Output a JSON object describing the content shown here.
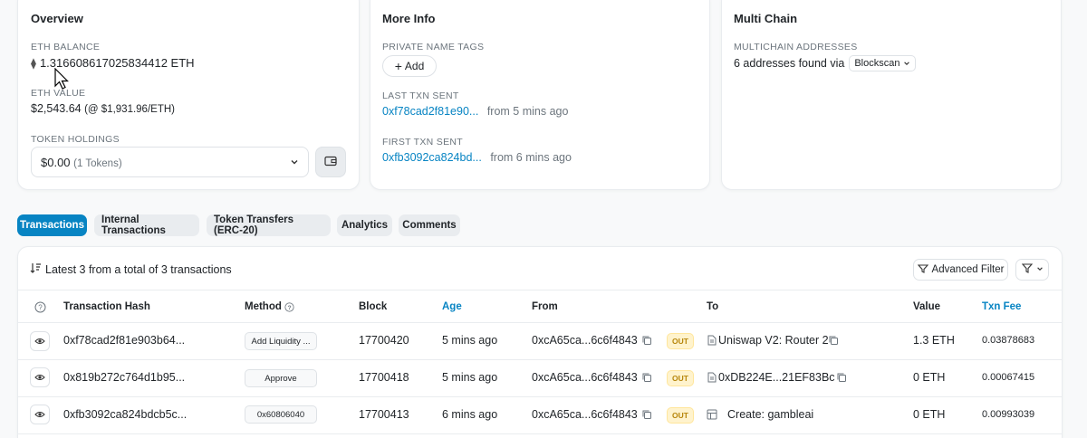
{
  "overview": {
    "title": "Overview",
    "eth_balance_label": "ETH BALANCE",
    "eth_balance_value": "1.316608617025834412 ETH",
    "eth_value_label": "ETH VALUE",
    "eth_value_usd": "$2,543.64",
    "eth_value_rate": "(@ $1,931.96/ETH)",
    "token_holdings_label": "TOKEN HOLDINGS",
    "token_holdings_value": "$0.00",
    "token_holdings_count": "(1 Tokens)"
  },
  "more_info": {
    "title": "More Info",
    "private_name_tags_label": "PRIVATE NAME TAGS",
    "add_label": "Add",
    "last_txn_label": "LAST TXN SENT",
    "last_txn_hash": "0xf78cad2f81e90...",
    "last_txn_time": "from 5 mins ago",
    "first_txn_label": "FIRST TXN SENT",
    "first_txn_hash": "0xfb3092ca824bd...",
    "first_txn_time": "from 6 mins ago"
  },
  "multi_chain": {
    "title": "Multi Chain",
    "addresses_label": "MULTICHAIN ADDRESSES",
    "addresses_text": "6 addresses found via",
    "provider": "Blockscan"
  },
  "tabs": [
    "Transactions",
    "Internal Transactions",
    "Token Transfers (ERC-20)",
    "Analytics",
    "Comments"
  ],
  "tx_summary": "Latest 3 from a total of 3 transactions",
  "advanced_filter_label": "Advanced Filter",
  "table": {
    "headers": {
      "hash": "Transaction Hash",
      "method": "Method",
      "block": "Block",
      "age": "Age",
      "from": "From",
      "to": "To",
      "value": "Value",
      "fee": "Txn Fee"
    },
    "rows": [
      {
        "hash": "0xf78cad2f81e903b64...",
        "method": "Add Liquidity ...",
        "block": "17700420",
        "age": "5 mins ago",
        "from": "0xcA65ca...6c6f4843",
        "direction": "OUT",
        "to": "Uniswap V2: Router 2",
        "value": "1.3 ETH",
        "fee": "0.03878683"
      },
      {
        "hash": "0x819b272c764d1b95...",
        "method": "Approve",
        "block": "17700418",
        "age": "5 mins ago",
        "from": "0xcA65ca...6c6f4843",
        "direction": "OUT",
        "to": "0xDB224E...21EF83Bc",
        "value": "0 ETH",
        "fee": "0.00067415"
      },
      {
        "hash": "0xfb3092ca824bdcb5c...",
        "method": "0x60806040",
        "block": "17700413",
        "age": "6 mins ago",
        "from": "0xcA65ca...6c6f4843",
        "direction": "OUT",
        "to": "Create: gambleai",
        "value": "0 ETH",
        "fee": "0.00993039"
      }
    ]
  },
  "colors": {
    "accent": "#0784c3",
    "out_badge_bg": "#fff3cd",
    "out_badge_text": "#b7860b"
  }
}
